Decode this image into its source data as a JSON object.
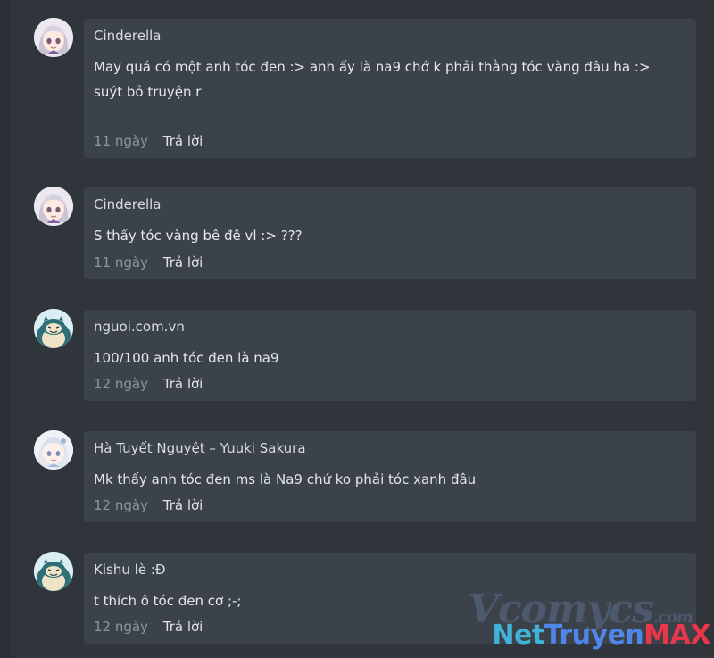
{
  "comments": [
    {
      "author": "Cinderella",
      "text": "May quá có một anh tóc đen :> anh ấy là na9 chớ k phải thằng tóc vàng đâu ha :> suýt bỏ truyện r",
      "time": "11 ngày",
      "reply_label": "Trả lời",
      "avatar_icon": "anime-girl-avatar"
    },
    {
      "author": "Cinderella",
      "text": "S thấy tóc vàng bê đê vl :> ???",
      "time": "11 ngày",
      "reply_label": "Trả lời",
      "avatar_icon": "anime-girl-avatar"
    },
    {
      "author": "nguoi.com.vn",
      "text": "100/100 anh tóc đen là na9",
      "time": "12 ngày",
      "reply_label": "Trả lời",
      "avatar_icon": "snorlax-avatar"
    },
    {
      "author": "Hà Tuyết Nguyệt – Yuuki Sakura",
      "text": "Mk thấy anh tóc đen ms là Na9 chứ ko phải tóc xanh đâu",
      "time": "12 ngày",
      "reply_label": "Trả lời",
      "avatar_icon": "anime-girl-avatar"
    },
    {
      "author": "Kishu lè :Đ",
      "text": "t thích ô tóc đen cơ ;-;",
      "time": "12 ngày",
      "reply_label": "Trả lời",
      "avatar_icon": "snorlax-avatar"
    }
  ],
  "watermark": {
    "faint_text": "Vcomycs",
    "faint_suffix": ".com",
    "brand_net": "Net",
    "brand_truyen": "Truyen",
    "brand_max": "MAX"
  },
  "colors": {
    "page_bg": "#30353b",
    "bubble_bg": "#3c4249",
    "time_text": "#8d96a0",
    "brand_red": "#e8374b",
    "brand_blue": "#4f86e8"
  }
}
